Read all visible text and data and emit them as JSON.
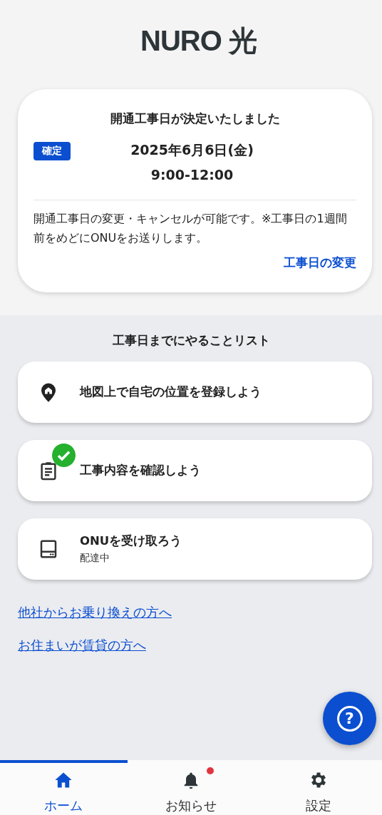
{
  "header": {
    "logo": "NURO 光"
  },
  "schedule_card": {
    "title": "開通工事日が決定いたしました",
    "badge": "確定",
    "date": "2025年6月6日(金)",
    "time": "9:00-12:00",
    "note": "開通工事日の変更・キャンセルが可能です。※工事日の1週間前をめどにONUをお送りします。",
    "link": "工事日の変更"
  },
  "todo": {
    "title": "工事日までにやることリスト",
    "items": [
      {
        "kind": "location",
        "label": "地図上で自宅の位置を登録しよう",
        "done": false
      },
      {
        "kind": "checklist",
        "label": "工事内容を確認しよう",
        "done": true
      },
      {
        "kind": "device",
        "label": "ONUを受け取ろう",
        "status": "配達中",
        "done": false
      }
    ]
  },
  "links": [
    "他社からお乗り換えの方へ",
    "お住まいが賃貸の方へ"
  ],
  "help_button": {
    "label": "?"
  },
  "tabs": [
    {
      "kind": "home",
      "label": "ホーム",
      "selected": true,
      "unread": false
    },
    {
      "kind": "bell",
      "label": "お知らせ",
      "selected": false,
      "unread": true
    },
    {
      "kind": "gear",
      "label": "設定",
      "selected": false,
      "unread": false
    }
  ]
}
